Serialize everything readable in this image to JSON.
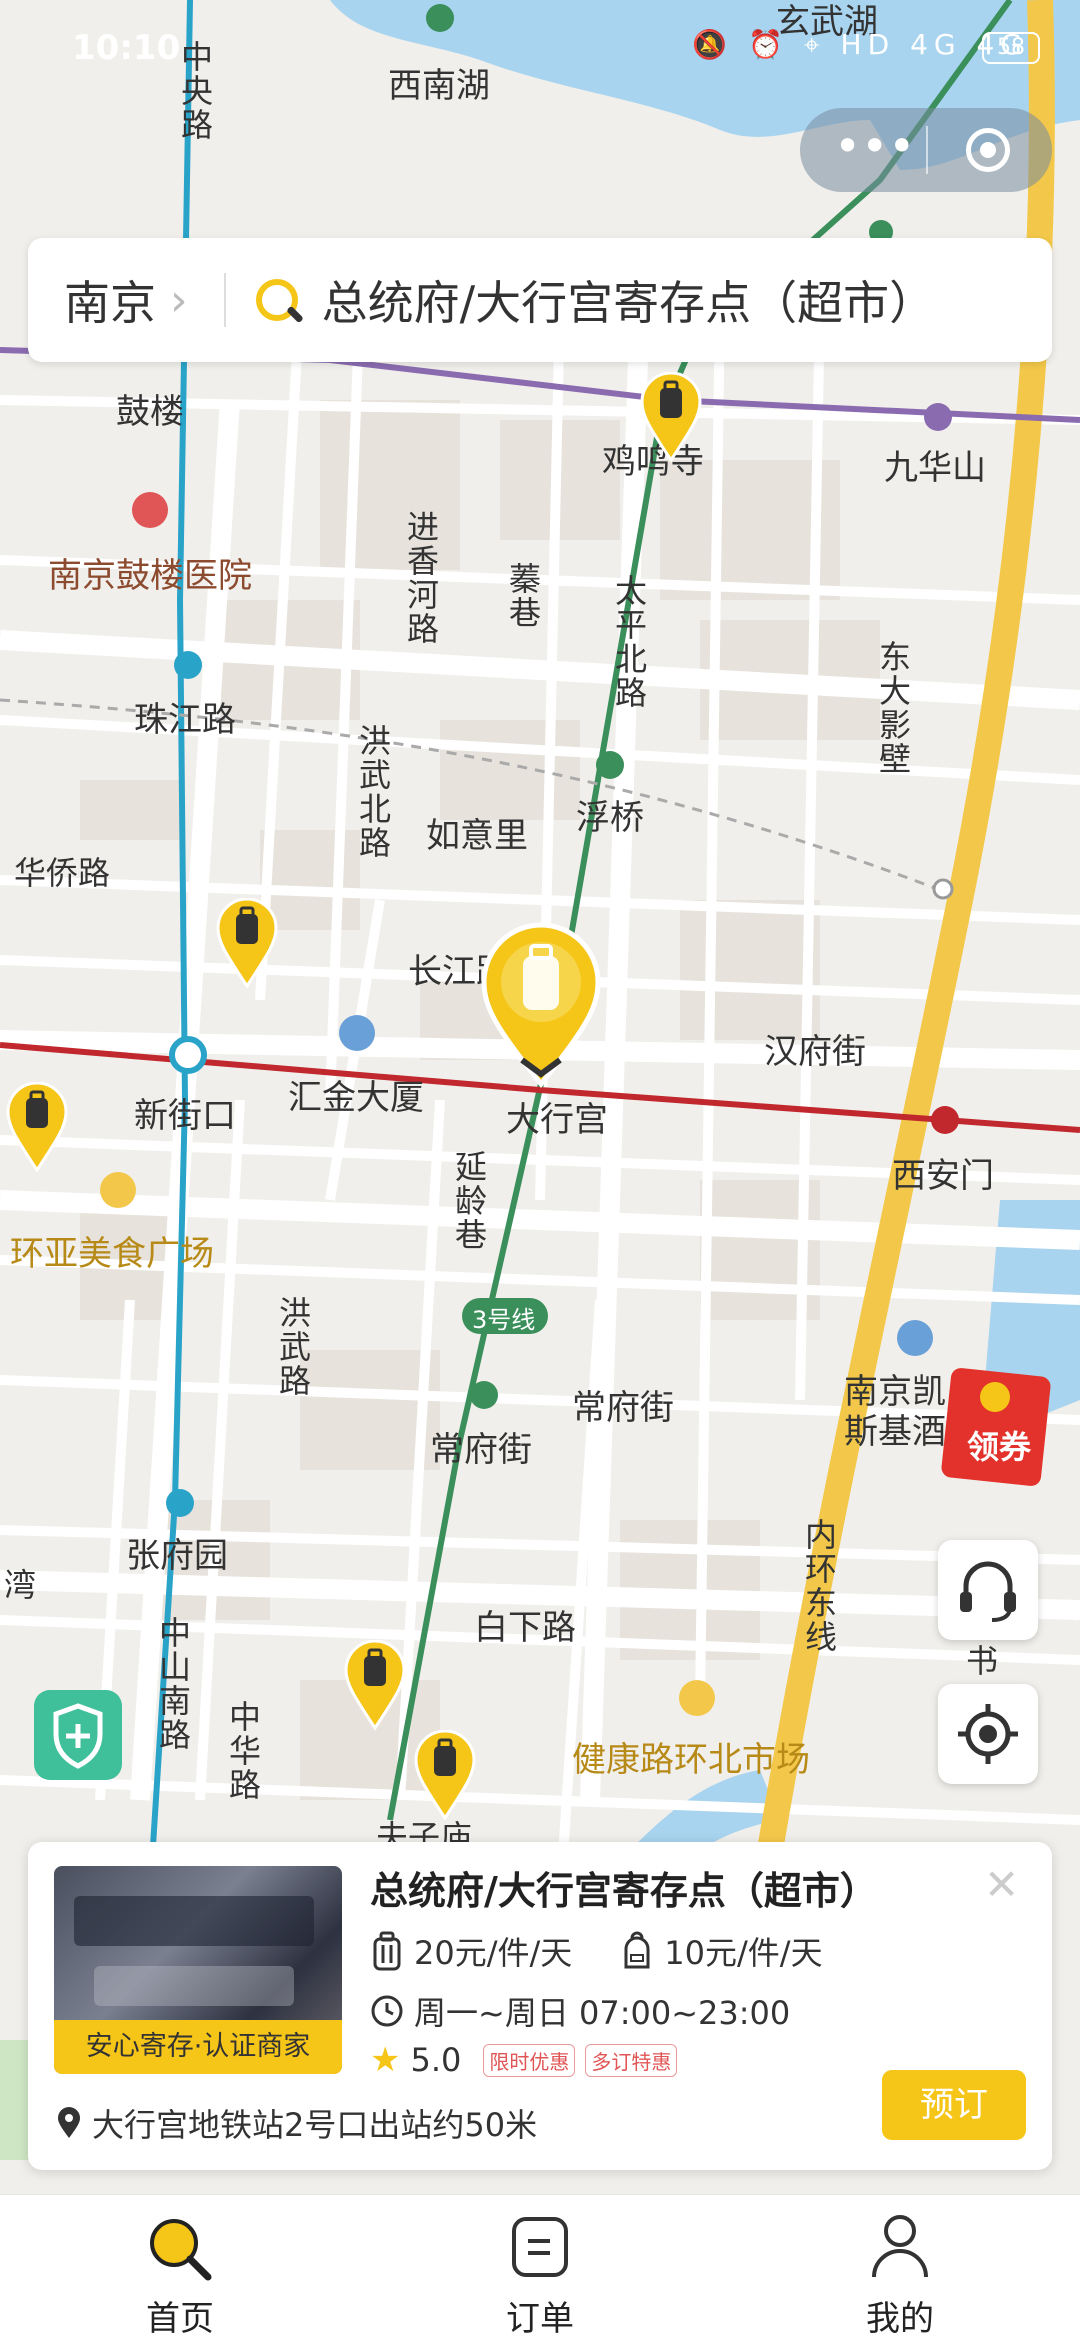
{
  "status_bar": {
    "time": "10:10",
    "icons": "🔕 ⏰ ⌖ HD 4G 4G",
    "battery": "58"
  },
  "search": {
    "city": "南京",
    "query": "总统府/大行宫寄存点（超市）"
  },
  "map_labels": {
    "xinanhu": "西南湖",
    "xuanwuhu": "玄武湖",
    "zhongyanglu": "中央路",
    "gulou": "鼓楼",
    "jimingsi": "鸡鸣寺",
    "jiuhuashan": "九华山",
    "hospital": "南京鼓楼医院",
    "jinxianghe": "进香河路",
    "zhenxiang": "蓁巷",
    "taipingbei": "太平北路",
    "dongdayingbi": "东大影壁",
    "zhujianglu_station": "珠江路",
    "hongwubei": "洪武北路",
    "ruyili": "如意里",
    "fuqiao": "浮桥",
    "huaqiaolu": "华侨路",
    "changjianglu": "长江路",
    "hanfujie": "汉府街",
    "huijin": "汇金大厦",
    "xinjiekou": "新街口",
    "daxinggong": "大行宫",
    "xianmen": "西安门",
    "huanya": "环亚美食广场",
    "yanlingxiang": "延龄巷",
    "line3": "3号线",
    "hongwulu": "洪武路",
    "changfujie": "常府街",
    "changfujie_station": "常府街",
    "kaisi": "南京凯斯基酒",
    "zhangfuyuan": "张府园",
    "neihuan": "内环东线",
    "zhongshannan": "中山南路",
    "baixialu": "白下路",
    "wan": "湾",
    "zhonghualu": "中华路",
    "jiankang": "健康路环北市场",
    "fuzimiao": "夫子庙",
    "shu": "书"
  },
  "red_packet": {
    "label": "领券"
  },
  "card": {
    "title": "总统府/大行宫寄存点（超市）",
    "badge": "安心寄存·认证商家",
    "luggage_price": "20元/件/天",
    "bag_price": "10元/件/天",
    "hours": "周一~周日 07:00~23:00",
    "rating": "5.0",
    "tags": [
      "限时优惠",
      "多订特惠"
    ],
    "location": "大行宫地铁站2号口出站约50米",
    "book_label": "预订"
  },
  "tabs": [
    {
      "label": "首页"
    },
    {
      "label": "订单"
    },
    {
      "label": "我的"
    }
  ],
  "colors": {
    "accent": "#f5c518",
    "metro_green": "#3a8f5b",
    "metro_red": "#c0282d",
    "metro_purple": "#8a6bb0",
    "metro_blue": "#2aa3c9",
    "water": "#a8d4ef",
    "road_yellow": "#f3c84a"
  }
}
